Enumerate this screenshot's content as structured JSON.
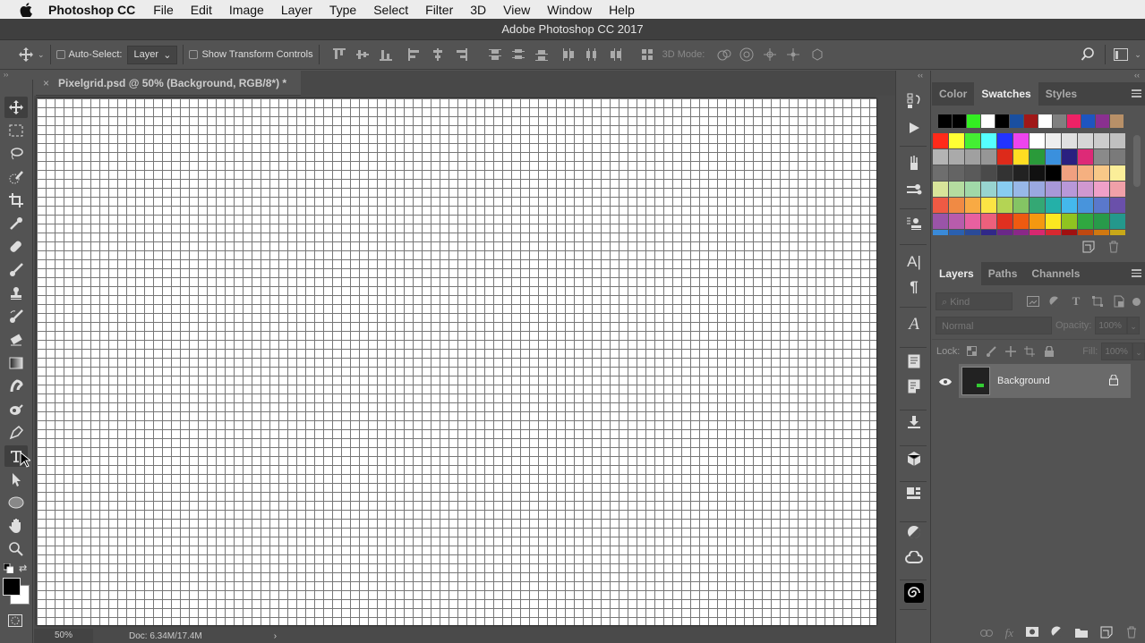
{
  "menubar": {
    "app": "Photoshop CC",
    "items": [
      "File",
      "Edit",
      "Image",
      "Layer",
      "Type",
      "Select",
      "Filter",
      "3D",
      "View",
      "Window",
      "Help"
    ]
  },
  "window": {
    "title": "Adobe Photoshop CC 2017"
  },
  "options": {
    "auto_select_label": "Auto-Select:",
    "auto_select_value": "Layer",
    "show_transform_label": "Show Transform Controls",
    "mode3d_label": "3D Mode:"
  },
  "document": {
    "tab_label": "Pixelgrid.psd @ 50% (Background, RGB/8*) *",
    "close": "×"
  },
  "status": {
    "zoom": "50%",
    "doc_size": "Doc: 6.34M/17.4M",
    "arrow": "›"
  },
  "tools": [
    "move",
    "marquee",
    "lasso",
    "quick-selection",
    "crop",
    "eyedropper",
    "healing-brush",
    "brush",
    "clone-stamp",
    "history-brush",
    "eraser",
    "gradient",
    "smudge",
    "dodge",
    "pen",
    "type",
    "path-selection",
    "ellipse",
    "hand",
    "zoom"
  ],
  "colors": {
    "foreground": "#000000",
    "background": "#ffffff"
  },
  "swatches_panel": {
    "tabs": [
      "Color",
      "Swatches",
      "Styles"
    ],
    "active": "Swatches",
    "recent": [
      "#000000",
      "#000000",
      "#33ee22",
      "#ffffff",
      "#000000",
      "#1a4fa0",
      "#a01818",
      "#ffffff",
      "#808080",
      "#ee2266",
      "#1e55c0",
      "#8a3090",
      "#b89068"
    ],
    "rows": [
      [
        "#ff2a1a",
        "#ffff33",
        "#44ee33",
        "#55ffff",
        "#2233ff",
        "#ee44ee",
        "#ffffff",
        "#eeeeee",
        "#e0e0e0",
        "#d6d6d6",
        "#cccccc",
        "#c0c0c0"
      ],
      [
        "#b4b4b4",
        "#aaaaaa",
        "#a0a0a0",
        "#969696",
        "#dd2a1a",
        "#ffdd22",
        "#2a9a3a",
        "#3a90dd",
        "#2a2080",
        "#dd2a77",
        "#8a8a8a",
        "#7a7a7a"
      ],
      [
        "#6e6e6e",
        "#646464",
        "#5a5a5a",
        "#4a4a4a",
        "#333333",
        "#222222",
        "#111111",
        "#000000",
        "#f0a080",
        "#f5b080",
        "#f8c888",
        "#fbee99"
      ],
      [
        "#d8e49a",
        "#b4dca0",
        "#a0d8a8",
        "#98d4d0",
        "#88ccf0",
        "#98b8e8",
        "#9aa8e0",
        "#a898d8",
        "#b898d8",
        "#d098d0",
        "#f0a0c8",
        "#f0a0a8"
      ],
      [
        "#ee5a44",
        "#f08a44",
        "#f8aa44",
        "#fce444",
        "#b4d454",
        "#84c464",
        "#34a874",
        "#24b0a8",
        "#44b8ec",
        "#4894dc",
        "#5a78cc",
        "#6a50aa"
      ],
      [
        "#9a54a8",
        "#b85cac",
        "#e860a0",
        "#ec607c",
        "#e03020",
        "#ee5a10",
        "#f49810",
        "#fce820",
        "#90c420",
        "#30a840",
        "#289a4a",
        "#24988c"
      ],
      [
        "#3a8ad8",
        "#2a60b0",
        "#2a4a98",
        "#302888",
        "#6a2888",
        "#8a2888",
        "#d82870",
        "#d82830",
        "#a01010",
        "#c04810",
        "#d07810",
        "#c8a818"
      ]
    ]
  },
  "layers_panel": {
    "tabs": [
      "Layers",
      "Paths",
      "Channels"
    ],
    "active": "Layers",
    "filter_placeholder": "Kind",
    "blend_mode": "Normal",
    "opacity_label": "Opacity:",
    "opacity_value": "100%",
    "lock_label": "Lock:",
    "fill_label": "Fill:",
    "fill_value": "100%",
    "layers": [
      {
        "name": "Background",
        "visible": true,
        "locked": true
      }
    ]
  }
}
